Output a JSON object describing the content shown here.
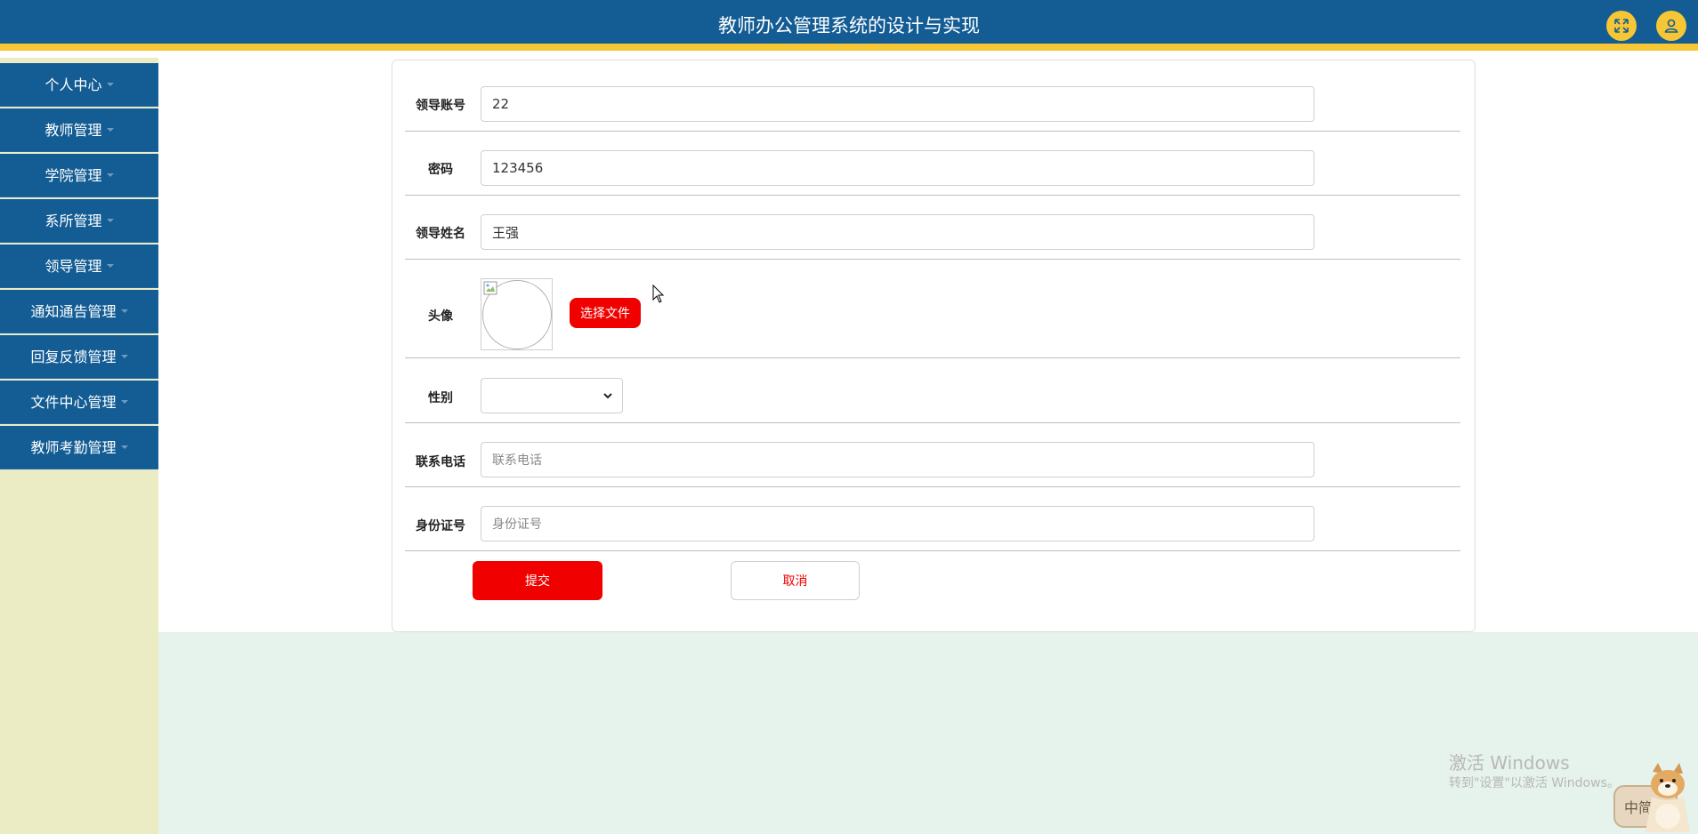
{
  "header": {
    "title": "教师办公管理系统的设计与实现",
    "icons": [
      "fullscreen-icon",
      "user-icon"
    ]
  },
  "sidebar": {
    "items": [
      {
        "label": "个人中心"
      },
      {
        "label": "教师管理"
      },
      {
        "label": "学院管理"
      },
      {
        "label": "系所管理"
      },
      {
        "label": "领导管理"
      },
      {
        "label": "通知通告管理"
      },
      {
        "label": "回复反馈管理"
      },
      {
        "label": "文件中心管理"
      },
      {
        "label": "教师考勤管理"
      }
    ]
  },
  "form": {
    "account": {
      "label": "领导账号",
      "value": "22"
    },
    "password": {
      "label": "密码",
      "value": "123456"
    },
    "name": {
      "label": "领导姓名",
      "value": "王强"
    },
    "avatar": {
      "label": "头像",
      "button": "选择文件"
    },
    "gender": {
      "label": "性别",
      "value": ""
    },
    "phone": {
      "label": "联系电话",
      "value": "",
      "placeholder": "联系电话"
    },
    "idcard": {
      "label": "身份证号",
      "value": "",
      "placeholder": "身份证号"
    },
    "submit": "提交",
    "cancel": "取消"
  },
  "watermark": {
    "title": "激活 Windows",
    "subtitle": "转到\"设置\"以激活 Windows。"
  },
  "ime": {
    "label": "中简"
  },
  "colors": {
    "header": "#135c94",
    "accent_gold": "#f6c635",
    "sidebar_bg": "#ececc4",
    "primary_red": "#f10000",
    "content_bottom": "#e6f2ec"
  }
}
